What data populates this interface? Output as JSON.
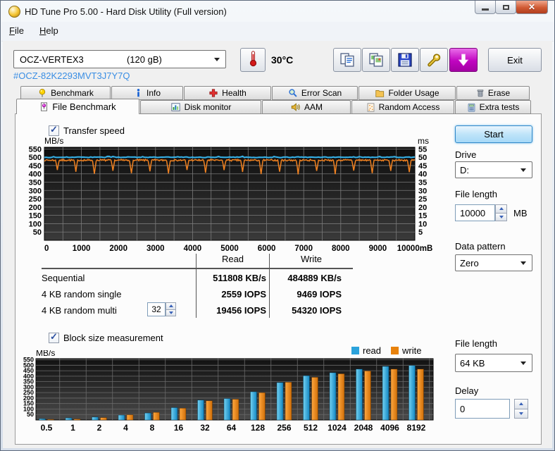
{
  "window": {
    "title": "HD Tune Pro 5.00 - Hard Disk Utility (Full version)"
  },
  "menu": {
    "items": [
      "File",
      "Help"
    ]
  },
  "toolbar": {
    "drive_name": "OCZ-VERTEX3",
    "drive_size": "(120 gB)",
    "serial": "#OCZ-82K2293MVT3J7Y7Q",
    "temperature": "30°C",
    "exit": "Exit",
    "buttons": [
      {
        "icon": "copy-text-icon"
      },
      {
        "icon": "copy-image-icon"
      },
      {
        "icon": "save-icon"
      },
      {
        "icon": "options-icon"
      },
      {
        "icon": "download-icon"
      }
    ]
  },
  "tabs": {
    "row1": [
      {
        "label": "Benchmark",
        "icon": "benchmark-icon"
      },
      {
        "label": "Info",
        "icon": "info-icon"
      },
      {
        "label": "Health",
        "icon": "health-icon"
      },
      {
        "label": "Error Scan",
        "icon": "error-scan-icon"
      },
      {
        "label": "Folder Usage",
        "icon": "folder-usage-icon"
      },
      {
        "label": "Erase",
        "icon": "erase-icon"
      }
    ],
    "row2": [
      {
        "label": "File Benchmark",
        "icon": "file-benchmark-icon"
      },
      {
        "label": "Disk monitor",
        "icon": "disk-monitor-icon"
      },
      {
        "label": "AAM",
        "icon": "aam-icon"
      },
      {
        "label": "Random Access",
        "icon": "random-access-icon"
      },
      {
        "label": "Extra tests",
        "icon": "extra-tests-icon"
      }
    ],
    "active": "File Benchmark"
  },
  "sections": {
    "transfer": "Transfer speed",
    "block": "Block size measurement"
  },
  "controls": {
    "start": "Start",
    "drive_label": "Drive",
    "drive_value": "D:",
    "file_length_label": "File length",
    "file_length_value": "10000",
    "file_length_unit": "MB",
    "data_pattern_label": "Data pattern",
    "data_pattern_value": "Zero",
    "block_file_length_label": "File length",
    "block_file_length_value": "64 KB",
    "delay_label": "Delay",
    "delay_value": "0"
  },
  "results_table": {
    "col_headers": [
      "Read",
      "Write"
    ],
    "rows": [
      {
        "label": "Sequential",
        "read": "511808 KB/s",
        "write": "484889 KB/s"
      },
      {
        "label": "4 KB random single",
        "read": "2559 IOPS",
        "write": "9469 IOPS"
      },
      {
        "label": "4 KB random multi",
        "threads": "32",
        "read": "19456 IOPS",
        "write": "54320 IOPS"
      }
    ]
  },
  "chart_data": [
    {
      "id": "transfer_speed",
      "type": "line",
      "title": "Transfer speed",
      "ylabel_left": "MB/s",
      "ylabel_right": "ms",
      "x_range": [
        0,
        10000
      ],
      "x_ticks": [
        "0",
        "1000",
        "2000",
        "3000",
        "4000",
        "5000",
        "6000",
        "7000",
        "8000",
        "9000",
        "10000mB"
      ],
      "y_ticks_left": [
        550,
        500,
        450,
        400,
        350,
        300,
        250,
        200,
        150,
        100,
        50
      ],
      "y_ticks_right": [
        55,
        50,
        45,
        40,
        35,
        30,
        25,
        20,
        15,
        10,
        5
      ],
      "ylim": [
        0,
        560
      ],
      "grid": true,
      "series": [
        {
          "name": "read",
          "color": "#36b3ea",
          "avg_mbps": 500,
          "noise_mbps": 4
        },
        {
          "name": "write",
          "color": "#ef8121",
          "avg_mbps": 482,
          "noise_mbps": 8,
          "dip_min_mbps": 400,
          "dip_interval_mb": 500,
          "first_dip_mb": 350,
          "dip_width_mb": 50
        }
      ]
    },
    {
      "id": "block_size",
      "type": "bar",
      "ylabel": "MB/s",
      "categories": [
        "0.5",
        "1",
        "2",
        "4",
        "8",
        "16",
        "32",
        "64",
        "128",
        "256",
        "512",
        "1024",
        "2048",
        "4096",
        "8192"
      ],
      "y_ticks": [
        550,
        500,
        450,
        400,
        350,
        300,
        250,
        200,
        150,
        100,
        50
      ],
      "ylim": [
        0,
        560
      ],
      "grid": true,
      "legend_position": "top-right",
      "series": [
        {
          "name": "read",
          "color": "#2ba3dc",
          "values": [
            12,
            19,
            27,
            45,
            64,
            113,
            182,
            196,
            258,
            342,
            405,
            432,
            465,
            490,
            498
          ]
        },
        {
          "name": "write",
          "color": "#e8820c",
          "values": [
            6,
            9,
            22,
            48,
            70,
            108,
            176,
            190,
            250,
            345,
            390,
            422,
            448,
            465,
            465
          ]
        }
      ]
    }
  ]
}
